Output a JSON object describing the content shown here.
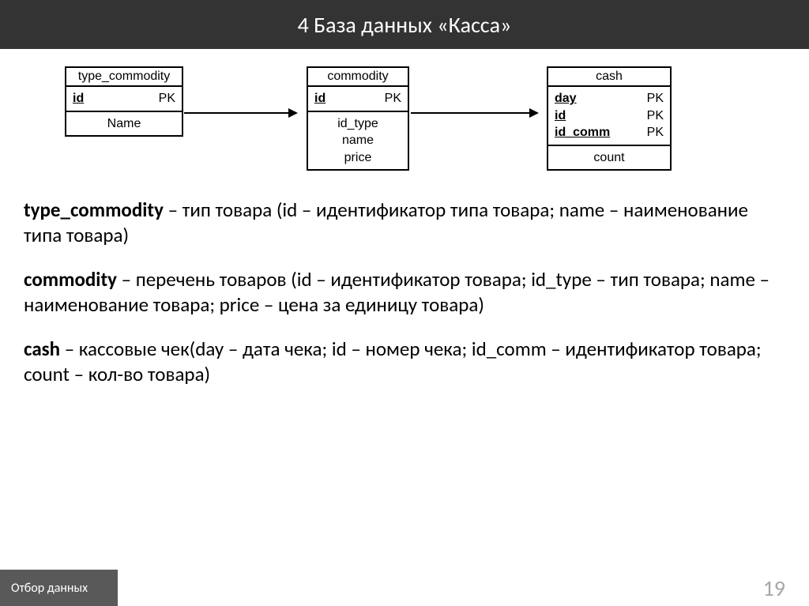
{
  "header": {
    "title": "4  База данных «Касса»"
  },
  "tables": {
    "t1": {
      "name": "type_commodity",
      "keys": [
        {
          "field": "id",
          "mark": "PK"
        }
      ],
      "attrs": [
        "Name"
      ]
    },
    "t2": {
      "name": "commodity",
      "keys": [
        {
          "field": "id",
          "mark": "PK"
        }
      ],
      "attrs": [
        "id_type",
        "name",
        "price"
      ]
    },
    "t3": {
      "name": "cash",
      "keys": [
        {
          "field": "day",
          "mark": "PK"
        },
        {
          "field": "id",
          "mark": "PK"
        },
        {
          "field": "id_comm",
          "mark": "PK"
        }
      ],
      "attrs": [
        "count"
      ]
    }
  },
  "desc": {
    "p1": {
      "bold": "type_commodity",
      "rest": " – тип товара (id – идентификатор типа товара; name – наименование типа товара)"
    },
    "p2": {
      "bold": "commodity",
      "rest": " – перечень товаров (id – идентификатор товара; id_type – тип товара; name – наименование товара; price – цена за единицу товара)"
    },
    "p3": {
      "bold": "cash",
      "rest": " – кассовые чек(day – дата чека; id – номер чека; id_comm – идентификатор товара; count – кол-во товара)"
    }
  },
  "footer": {
    "label": "Отбор данных",
    "page": "19"
  }
}
